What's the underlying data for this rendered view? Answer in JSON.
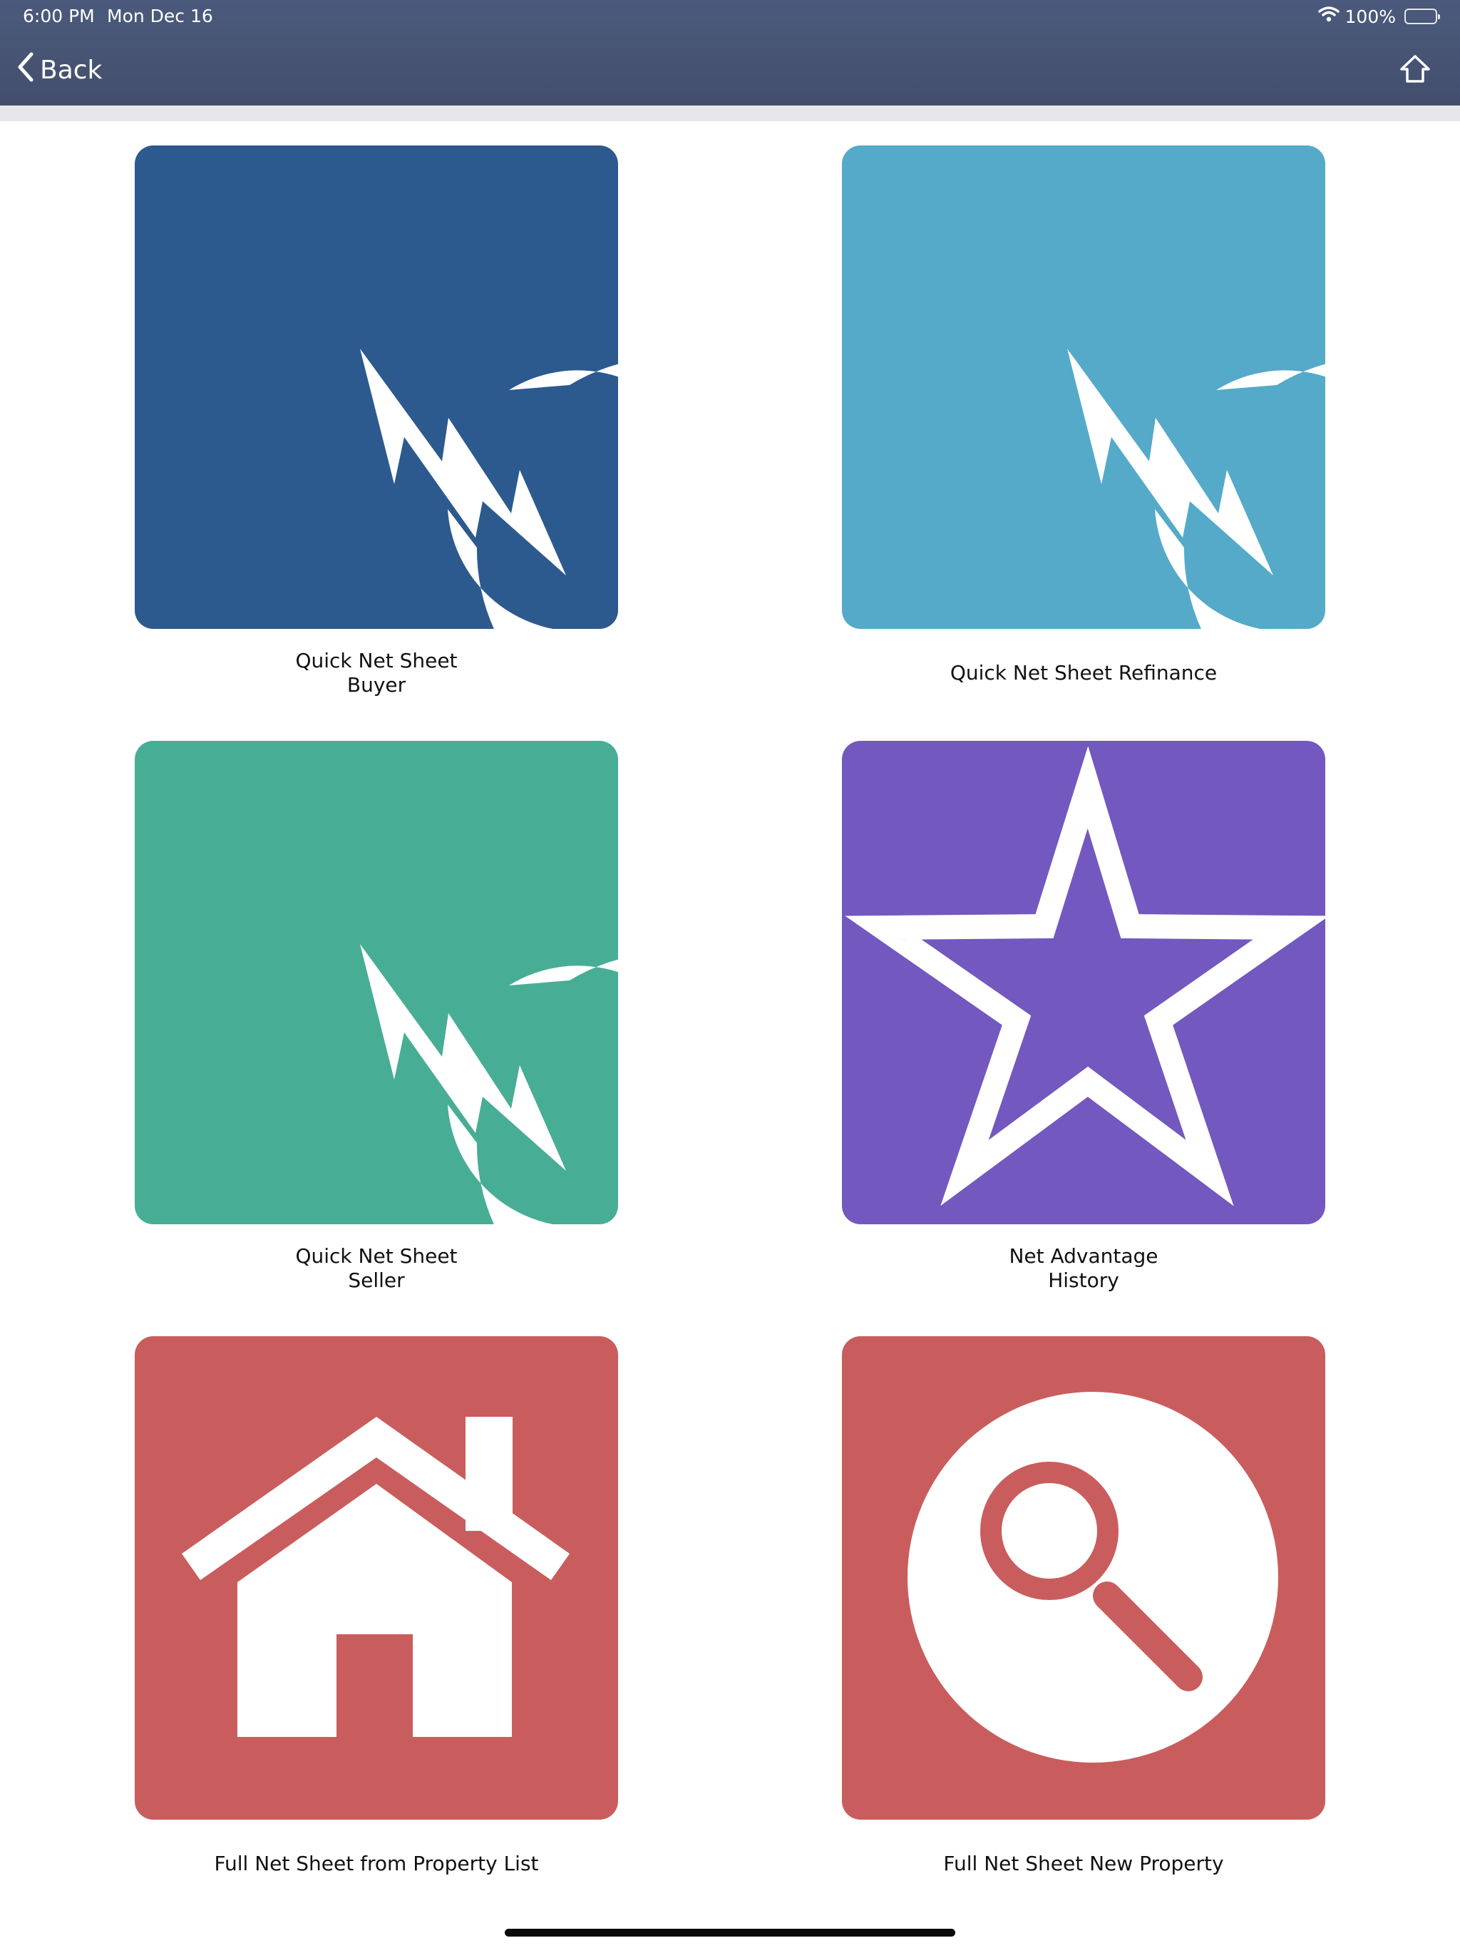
{
  "status_bar": {
    "time": "6:00 PM",
    "date": "Mon Dec 16",
    "battery": "100%"
  },
  "nav": {
    "back_label": "Back"
  },
  "tiles": [
    {
      "line1": "Quick Net Sheet",
      "line2": "Buyer",
      "color": "#2c5a8f",
      "icon": "q-lightning-icon"
    },
    {
      "line1": "Quick Net Sheet Refinance",
      "line2": "",
      "color": "#54aac8",
      "icon": "q-lightning-icon"
    },
    {
      "line1": "Quick Net Sheet",
      "line2": "Seller",
      "color": "#48ad95",
      "icon": "q-lightning-icon"
    },
    {
      "line1": "Net Advantage",
      "line2": "History",
      "color": "#7358bf",
      "icon": "star-icon"
    },
    {
      "line1": "Full Net Sheet from Property List",
      "line2": "",
      "color": "#c95d5d",
      "icon": "house-icon"
    },
    {
      "line1": "Full Net Sheet New Property",
      "line2": "",
      "color": "#c95d5d",
      "icon": "magnifier-icon"
    }
  ]
}
